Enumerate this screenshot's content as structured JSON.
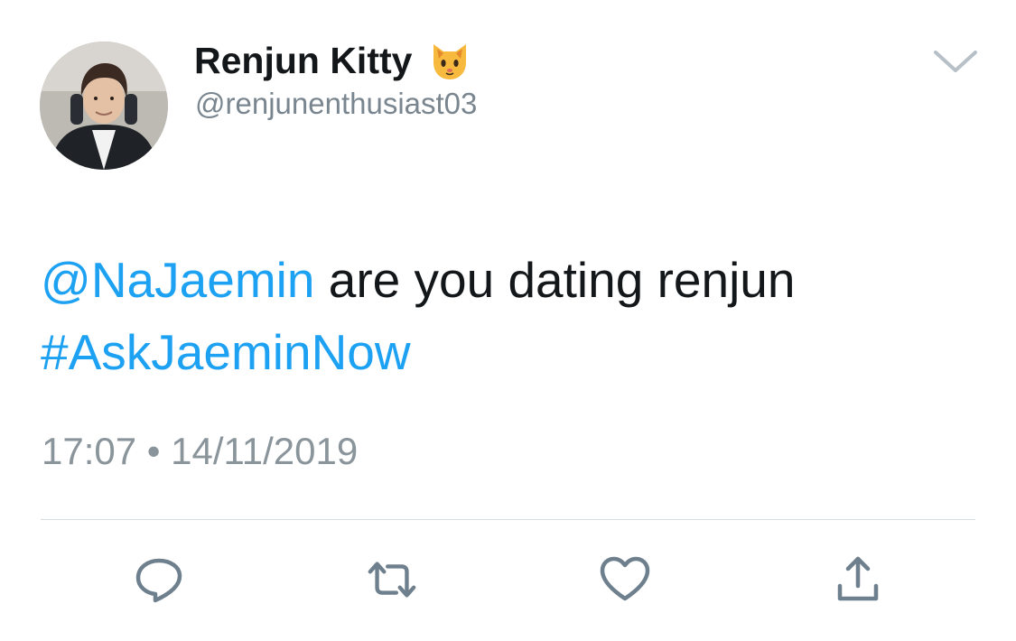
{
  "tweet": {
    "author": {
      "display_name": "Renjun Kitty",
      "emoji": "🐱",
      "handle": "@renjunenthusiast03",
      "avatar_icon": "profile-photo"
    },
    "text": {
      "mention": "@NaJaemin",
      "body": " are you dating renjun",
      "hashtag": "#AskJaeminNow"
    },
    "timestamp": "17:07 • 14/11/2019"
  },
  "icons": {
    "menu": "chevron-down-icon",
    "reply": "reply-icon",
    "retweet": "retweet-icon",
    "like": "heart-icon",
    "share": "share-icon"
  },
  "colors": {
    "link": "#1da1f2",
    "icon": "#6e7f8d",
    "secondary_text": "#8a949b",
    "primary_text": "#14171a"
  }
}
